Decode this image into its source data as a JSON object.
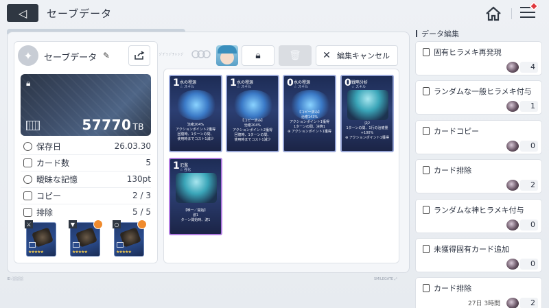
{
  "header": {
    "back_label": "◁",
    "title": "セーブデータ"
  },
  "save": {
    "name": "セーブデータ",
    "toolbar_small_text": "ｼﾞﾃﾞﾗ ｼﾞﾁ ﾄ  ｼ ｼﾞ",
    "tb_value": "57770",
    "tb_unit": "TB"
  },
  "stats": [
    {
      "label": "保存日",
      "value": "26.03.30",
      "icon": "clock-icon"
    },
    {
      "label": "カード数",
      "value": "5",
      "icon": "card-icon"
    },
    {
      "label": "曖昧な記憶",
      "value": "130pt",
      "icon": "brain-icon"
    },
    {
      "label": "コピー",
      "value": "2 / 3",
      "icon": "copy-icon"
    },
    {
      "label": "排除",
      "value": "5 / 5",
      "icon": "remove-icon"
    }
  ],
  "equipment": [
    {
      "type_icon": "sword-icon",
      "stars": "★★★★★"
    },
    {
      "type_icon": "armor-icon",
      "stars": "★★★★★"
    },
    {
      "type_icon": "ring-icon",
      "stars": "★★★★★"
    }
  ],
  "toolbar": {
    "cancel_label": "編集キャンセル"
  },
  "cards": [
    {
      "cost": "1",
      "name": "水の橙源",
      "type": "☆ スキル",
      "lines": [
        "治癒204%",
        "アクションポイント2獲得",
        "回復時、1ターンの間、",
        "使用時までコスト1減少"
      ]
    },
    {
      "cost": "1",
      "name": "水の橙源",
      "type": "☆ スキル",
      "lines": [
        "【コピー済み】",
        "治癒204%",
        "アクションポイント2獲得",
        "回復時、1ターンの間、",
        "使用時までコスト1減少"
      ]
    },
    {
      "cost": "0",
      "name": "水の橙源",
      "type": "☆ スキル",
      "lines": [
        "【コピー済み】",
        "治癒143%",
        "アクションポイント1獲得",
        "1ターンの間、決算1",
        "⊕ アクションポイント1獲得"
      ]
    },
    {
      "cost": "0",
      "name": "戦略分析",
      "type": "☆ スキル",
      "lines": [
        "決2",
        "1ターンの間、1行の治癒量+100%",
        "⊕ アクションポイント1獲得"
      ]
    },
    {
      "cost": "1",
      "name": "氾濫",
      "type": "☆ 強化",
      "lines": [
        "【唯一／開始】",
        "波1",
        "ターン開始時、波1"
      ]
    }
  ],
  "right_panel": {
    "title": "データ編集",
    "items": [
      {
        "label": "固有ヒラメキ再発現",
        "count": "4",
        "icon": "cards-icon"
      },
      {
        "label": "ランダムな一般ヒラメキ付与",
        "count": "1",
        "icon": "cards-icon"
      },
      {
        "label": "カードコピー",
        "count": "0",
        "icon": "copy-icon"
      },
      {
        "label": "カード排除",
        "count": "2",
        "icon": "remove-icon"
      },
      {
        "label": "ランダムな神ヒラメキ付与",
        "count": "0",
        "icon": "cards-icon"
      },
      {
        "label": "未獲得固有カード追加",
        "count": "0",
        "icon": "cards-icon"
      },
      {
        "label": "カード排除",
        "count": "2",
        "icon": "remove-icon",
        "time": "27日 3時間"
      }
    ]
  },
  "footer": {
    "left": "ID: ░░░░",
    "right": "SMILEGATE ⤢"
  }
}
